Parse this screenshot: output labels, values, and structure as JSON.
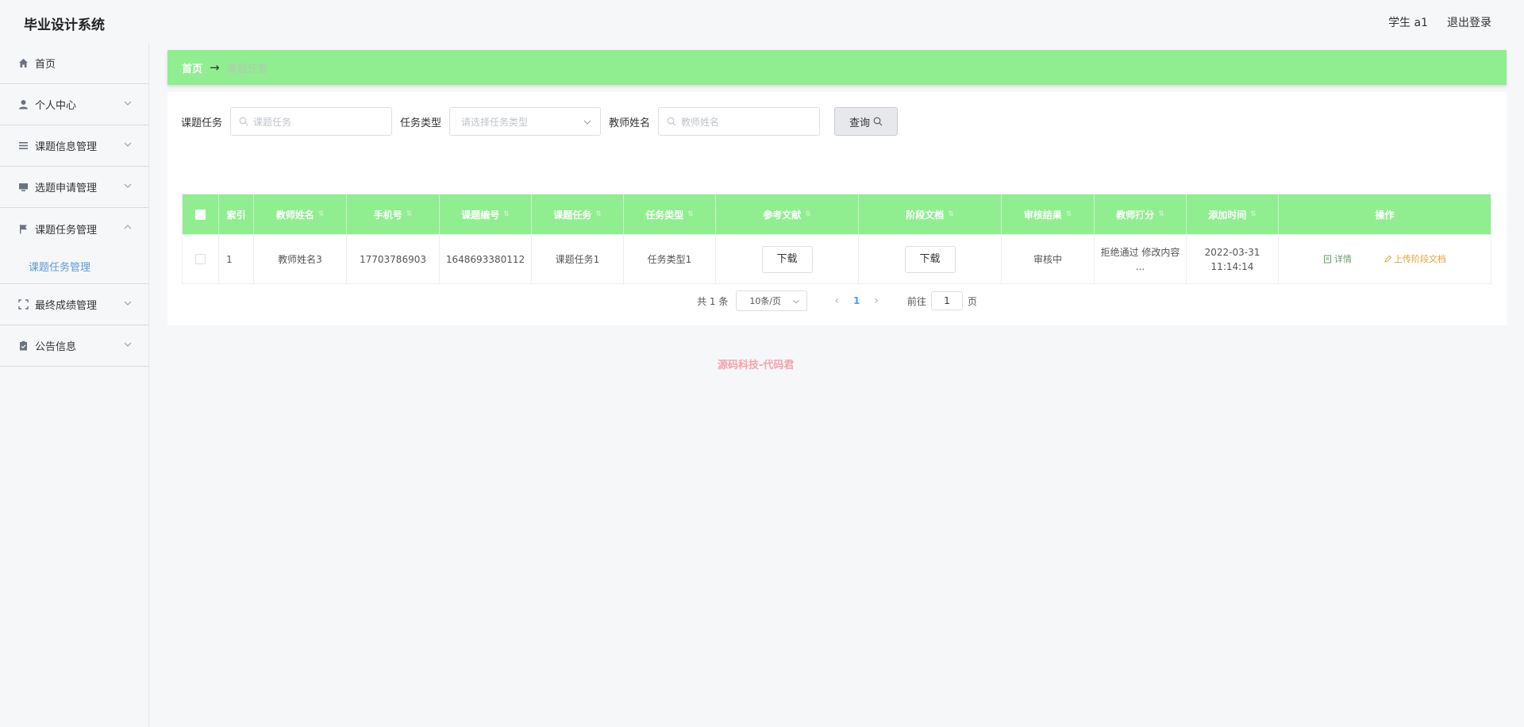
{
  "header": {
    "title": "毕业设计系统",
    "user": "学生 a1",
    "logout": "退出登录"
  },
  "sidebar": {
    "items": [
      {
        "label": "首页",
        "icon": "home-icon"
      },
      {
        "label": "个人中心",
        "icon": "user-icon"
      },
      {
        "label": "课题信息管理",
        "icon": "list-icon"
      },
      {
        "label": "选题申请管理",
        "icon": "monitor-icon"
      },
      {
        "label": "课题任务管理",
        "icon": "flag-icon",
        "expanded": true,
        "children": [
          "课题任务管理"
        ]
      },
      {
        "label": "最终成绩管理",
        "icon": "fullscreen-icon"
      },
      {
        "label": "公告信息",
        "icon": "clipboard-icon"
      }
    ]
  },
  "breadcrumb": {
    "home": "首页",
    "separator": "→",
    "current": "课题任务"
  },
  "search": {
    "task_label": "课题任务",
    "task_placeholder": "课题任务",
    "type_label": "任务类型",
    "type_placeholder": "请选择任务类型",
    "teacher_label": "教师姓名",
    "teacher_placeholder": "教师姓名",
    "query_button": "查询"
  },
  "table": {
    "headers": [
      "索引",
      "教师姓名",
      "手机号",
      "课题编号",
      "课题任务",
      "任务类型",
      "参考文献",
      "阶段文档",
      "审核结果",
      "教师打分",
      "添加时间",
      "操作"
    ],
    "rows": [
      {
        "index": "1",
        "teacher": "教师姓名3",
        "phone": "17703786903",
        "topic_no": "1648693380112",
        "task": "课题任务1",
        "task_type": "任务类型1",
        "reference": "下载",
        "stage_doc": "下载",
        "review": "审核中",
        "score": "拒绝通过 修改内容 ...",
        "added_time": "2022-03-31 11:14:14",
        "op_detail": "详情",
        "op_upload": "上传阶段文档"
      }
    ]
  },
  "pagination": {
    "total": "共 1 条",
    "page_size": "10条/页",
    "current_page": "1",
    "goto_label": "前往",
    "goto_value": "1",
    "page_unit": "页"
  },
  "footer": {
    "text": "源码科技-代码君"
  },
  "colors": {
    "accent_green": "#90ee90",
    "submenu_blue": "#5b9bd5",
    "upload_orange": "#e6a23c",
    "footer_pink": "#f4a3a8"
  }
}
